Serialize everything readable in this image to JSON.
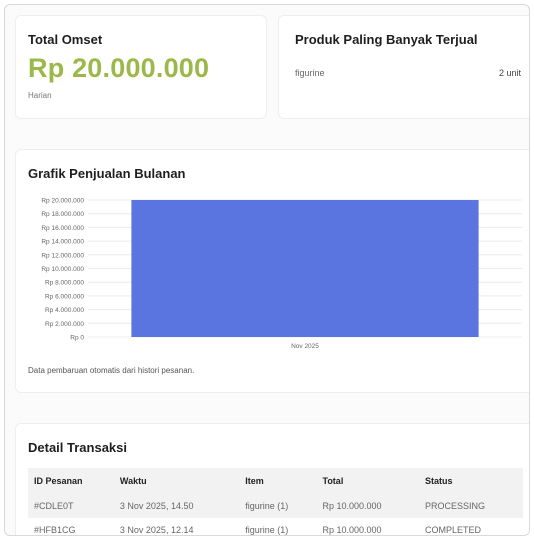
{
  "omset": {
    "title": "Total Omset",
    "value": "Rp 20.000.000",
    "period": "Harian"
  },
  "produk": {
    "title": "Produk Paling Banyak Terjual",
    "items": [
      {
        "name": "figurine",
        "qty": "2 unit"
      }
    ]
  },
  "chart": {
    "title": "Grafik Penjualan Bulanan",
    "note": "Data pembaruan otomatis dari histori pesanan."
  },
  "chart_data": {
    "type": "bar",
    "categories": [
      "Nov 2025"
    ],
    "values": [
      20000000
    ],
    "ylim": [
      0,
      20000000
    ],
    "yticks": [
      "Rp 0",
      "Rp 2.000.000",
      "Rp 4.000.000",
      "Rp 6.000.000",
      "Rp 8.000.000",
      "Rp 10.000.000",
      "Rp 12.000.000",
      "Rp 14.000.000",
      "Rp 16.000.000",
      "Rp 18.000.000",
      "Rp 20.000.000"
    ],
    "bar_color": "#5a75e0",
    "grid": true
  },
  "transaksi": {
    "title": "Detail Transaksi",
    "columns": [
      "ID Pesanan",
      "Waktu",
      "Item",
      "Total",
      "Status"
    ],
    "rows": [
      [
        "#CDLE0T",
        "3 Nov 2025, 14.50",
        "figurine (1)",
        "Rp 10.000.000",
        "PROCESSING"
      ],
      [
        "#HFB1CG",
        "3 Nov 2025, 12.14",
        "figurine (1)",
        "Rp 10.000.000",
        "COMPLETED"
      ]
    ]
  }
}
